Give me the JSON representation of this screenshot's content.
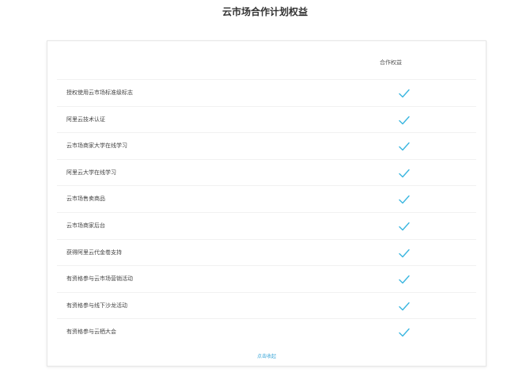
{
  "page": {
    "title": "云市场合作计划权益"
  },
  "table": {
    "column_header": "合作权益",
    "rows": [
      {
        "label": "授权使用云市场标准级标志",
        "checked": true
      },
      {
        "label": "阿里云技术认证",
        "checked": true
      },
      {
        "label": "云市场商家大学在线学习",
        "checked": true
      },
      {
        "label": "阿里云大学在线学习",
        "checked": true
      },
      {
        "label": "云市场售卖商品",
        "checked": true
      },
      {
        "label": "云市场商家后台",
        "checked": true
      },
      {
        "label": "获得阿里云代金卷支持",
        "checked": true
      },
      {
        "label": "有资格参与云市场营销活动",
        "checked": true
      },
      {
        "label": "有资格参与线下沙龙活动",
        "checked": true
      },
      {
        "label": "有资格参与云栖大会",
        "checked": true
      }
    ],
    "footer_link": "点击收起"
  },
  "colors": {
    "check": "#3ab6e0",
    "link": "#3aa6d8"
  },
  "icons": {
    "row_mark": "checkmark-icon"
  }
}
